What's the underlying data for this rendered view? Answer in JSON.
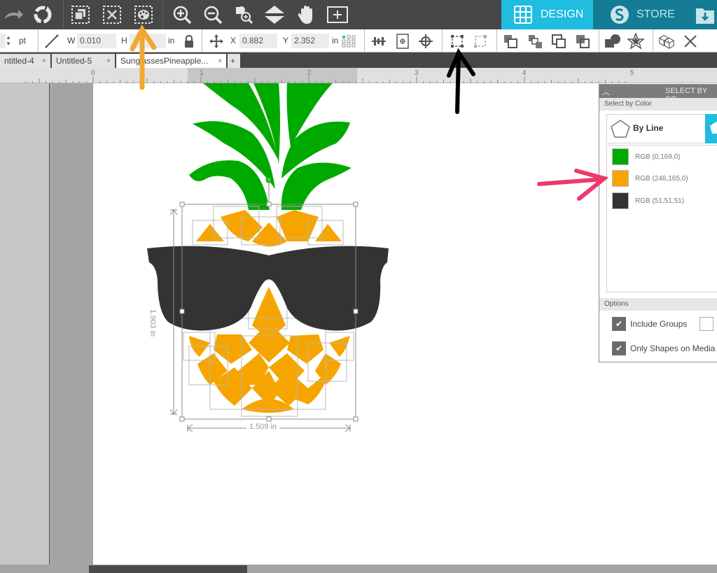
{
  "toolbar": {
    "icons": [
      "redo-icon",
      "refresh-icon",
      "group-icon",
      "ungroup-icon",
      "select-by-color-icon",
      "zoom-in-icon",
      "zoom-out-icon",
      "zoom-selection-icon",
      "pan-vertical-icon",
      "hand-icon",
      "fit-page-icon"
    ],
    "design_tab": "DESIGN",
    "store_tab": "STORE"
  },
  "properties": {
    "line_unit": "pt",
    "width_label": "W",
    "width_value": "0.010",
    "height_label": "H",
    "height_value": "",
    "size_unit": "in",
    "x_label": "X",
    "x_value": "0.882",
    "y_label": "Y",
    "y_value": "2.352",
    "pos_unit": "in"
  },
  "doc_tabs": [
    {
      "label": "ntitled-4",
      "close": "×"
    },
    {
      "label": "Untitled-5",
      "close": "×"
    },
    {
      "label": "SunglassesPineapple...",
      "close": "×",
      "active": true
    }
  ],
  "new_tab": "+",
  "ruler": {
    "ticks": [
      "0",
      "1",
      "2",
      "3",
      "4",
      "5"
    ]
  },
  "selection": {
    "width_readout": "1.509 in",
    "height_readout": "1.903 in"
  },
  "panel": {
    "title": "SELECT BY CO",
    "section_select": "Select by Color",
    "by_line_label": "By Line",
    "colors": [
      {
        "label": "RGB (0,169,0)",
        "hex": "#00a900"
      },
      {
        "label": "RGB (246,165,0)",
        "hex": "#f6a500"
      },
      {
        "label": "RGB (51,51,51)",
        "hex": "#333333"
      }
    ],
    "section_options": "Options",
    "options": [
      {
        "label": "Include Groups",
        "checked": true
      },
      {
        "label": "Only Shapes on Media",
        "checked": true
      }
    ]
  },
  "colors": {
    "accent": "#1fbde0",
    "store": "#147d95",
    "leaf": "#00a900",
    "fruit": "#f6a500",
    "glasses": "#333333",
    "annotation_orange": "#f0a830",
    "annotation_black": "#000000",
    "annotation_pink": "#f0386b"
  }
}
